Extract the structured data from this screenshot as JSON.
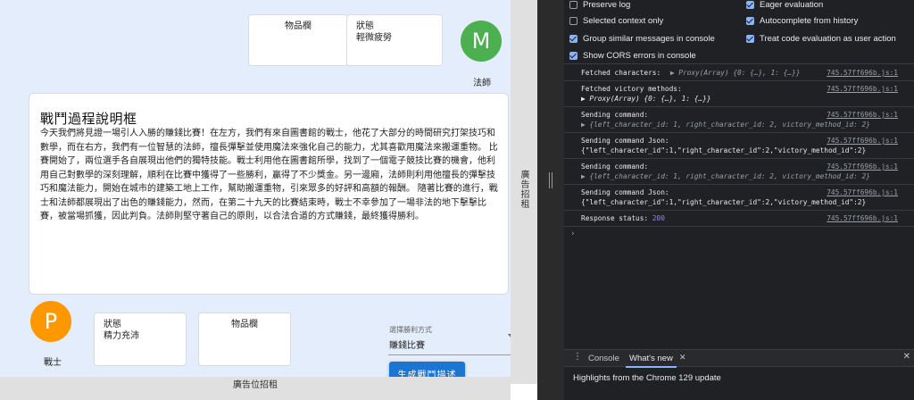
{
  "app": {
    "mage": {
      "avatar_letter": "M",
      "avatar_color": "#4caf50",
      "name": "法師",
      "inventory_label": "物品欄",
      "status_label": "狀態",
      "status_value": "輕微疲勞"
    },
    "warrior": {
      "avatar_letter": "P",
      "avatar_color": "#ff9800",
      "name": "戰士",
      "inventory_label": "物品欄",
      "status_label": "狀態",
      "status_value": "精力充沛"
    },
    "story": {
      "title": "戰鬥過程說明框",
      "text": "今天我們將見證一場引人入勝的賺錢比賽！在左方，我們有來自圖書館的戰士，他花了大部分的時間研究打架技巧和數學，而在右方，我們有一位智慧的法師，擅長彈擊並使用魔法來強化自己的能力，尤其喜歡用魔法來搬運重物。 比賽開始了，兩位選手各自展現出他們的獨特技能。戰士利用他在圖書館所學，找到了一個電子競技比賽的機會，他利用自己對數學的深刻理解，順利在比賽中獲得了一些勝利，贏得了不少獎金。另一邊廂，法師則利用他擅長的彈擊技巧和魔法能力，開始在城市的建築工地上工作，幫助搬運重物，引來眾多的好評和高額的報酬。 隨著比賽的進行，戰士和法師都展現出了出色的賺錢能力，然而，在第二十九天的比賽結束時，戰士不幸參加了一場非法的地下擊擊比賽，被當場抓獲，因此判負。法師則堅守著自己的原則，以合法合道的方式賺錢，最終獲得勝利。"
    },
    "ads": {
      "side": "廣告招租",
      "bottom": "廣告位招租"
    },
    "victory_select": {
      "label": "選擇勝利方式",
      "value": "賺錢比賽"
    },
    "generate_button": "生成戰鬥描述"
  },
  "devtools": {
    "settings": [
      {
        "label": "Preserve log",
        "checked": false
      },
      {
        "label": "Eager evaluation",
        "checked": true
      },
      {
        "label": "Selected context only",
        "checked": false
      },
      {
        "label": "Autocomplete from history",
        "checked": true
      },
      {
        "label": "Group similar messages in console",
        "checked": true
      },
      {
        "label": "Treat code evaluation as user action",
        "checked": true
      },
      {
        "label": "Show CORS errors in console",
        "checked": true
      }
    ],
    "logs": [
      {
        "line1": "Fetched characters: ",
        "line1_obj": "▶ Proxy(Array) {0: {…}, 1: {…}}",
        "source": "745.57ff696b.js:1"
      },
      {
        "line1": "Fetched victory methods:",
        "line2": " ▶ Proxy(Array) {0: {…}, 1: {…}}",
        "source": "745.57ff696b.js:1"
      },
      {
        "line1": "Sending command:",
        "line2": " ▶ {left_character_id: 1, right_character_id: 2, victory_method_id: 2}",
        "source": "745.57ff696b.js:1"
      },
      {
        "line1": "Sending command Json:",
        "line2": "{\"left_character_id\":1,\"right_character_id\":2,\"victory_method_id\":2}",
        "source": "745.57ff696b.js:1"
      },
      {
        "line1": "Sending command:",
        "line2": " ▶ {left_character_id: 1, right_character_id: 2, victory_method_id: 2}",
        "source": "745.57ff696b.js:1"
      },
      {
        "line1": "Sending command Json:",
        "line2": "{\"left_character_id\":1,\"right_character_id\":2,\"victory_method_id\":2}",
        "source": "745.57ff696b.js:1"
      },
      {
        "line1": "Response status: ",
        "line1_num": "200",
        "source": "745.57ff696b.js:1"
      }
    ],
    "prompt": "›",
    "drawer": {
      "menu": "⋮",
      "tab_console": "Console",
      "tab_whats_new": "What's new",
      "tab_close": "✕",
      "drawer_close": "✕",
      "highlights": "Highlights from the Chrome 129 update"
    }
  }
}
